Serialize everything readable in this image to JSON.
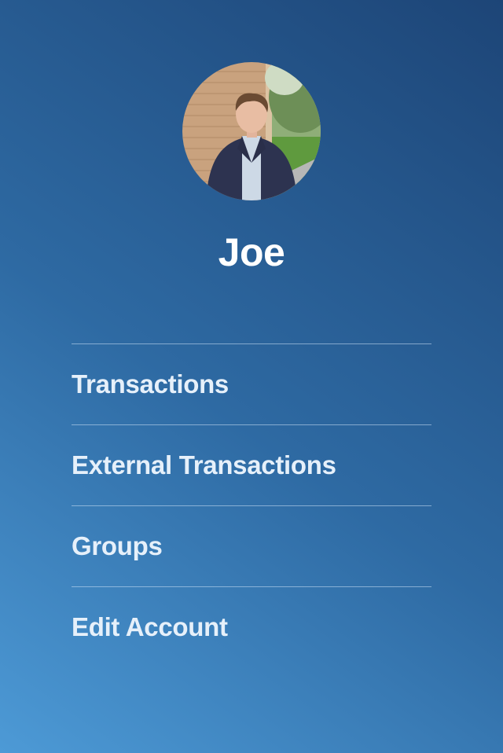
{
  "user": {
    "name": "Joe"
  },
  "menu": {
    "items": [
      {
        "label": "Transactions"
      },
      {
        "label": "External Transactions"
      },
      {
        "label": "Groups"
      },
      {
        "label": "Edit Account"
      }
    ]
  },
  "colors": {
    "gradient_light": "#4d9ad6",
    "gradient_mid": "#2e6aa3",
    "gradient_dark": "#1d4577",
    "text": "#e6f0fa"
  }
}
